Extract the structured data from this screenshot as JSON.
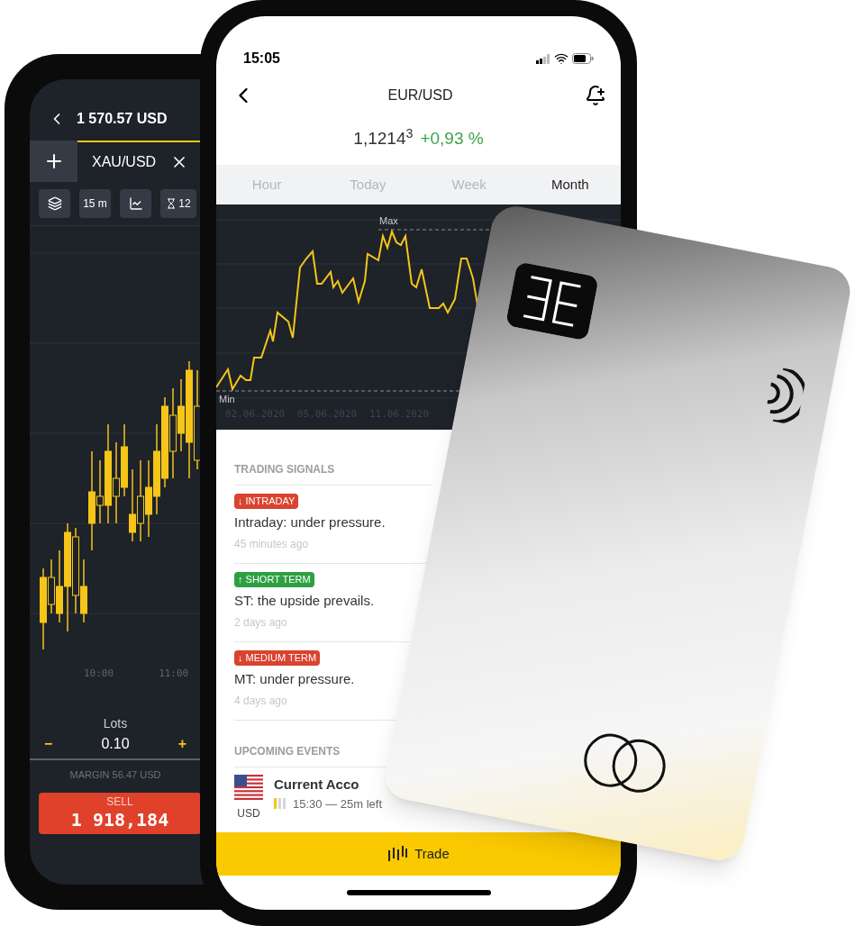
{
  "back_phone": {
    "header": {
      "balance": "1 570.57 USD"
    },
    "tabs": [
      {
        "label": "XAU/USD",
        "selected": true
      }
    ],
    "toolbar": {
      "interval": "15 m",
      "indicator_count": "12"
    },
    "chart": {
      "time_labels": [
        "10:00",
        "11:00"
      ]
    },
    "order": {
      "lots_label": "Lots",
      "minus": "−",
      "plus": "+",
      "lots_value": "0.10",
      "margin": "MARGIN 56.47 USD",
      "sell_label": "SELL",
      "sell_price": "1 918,184"
    }
  },
  "front_phone": {
    "status_bar": {
      "time": "15:05"
    },
    "header": {
      "title": "EUR/USD",
      "price": "1,1214$^{3}$",
      "change": "+0,93 %"
    },
    "periods": [
      {
        "label": "Hour",
        "selected": false
      },
      {
        "label": "Today",
        "selected": false
      },
      {
        "label": "Week",
        "selected": false
      },
      {
        "label": "Month",
        "selected": true
      }
    ],
    "chart": {
      "max_label": "Max",
      "min_label": "Min",
      "dates": [
        "02.06.2020",
        "05.06.2020",
        "11.06.2020"
      ]
    },
    "signals_title": "TRADING SIGNALS",
    "signals": [
      {
        "badge": "↓ INTRADAY",
        "color": "#d9432f",
        "text": "Intraday: under pressure.",
        "time": "45 minutes ago"
      },
      {
        "badge": "↑ SHORT TERM",
        "color": "#2ea043",
        "text": "ST: the upside prevails.",
        "time": "2 days ago"
      },
      {
        "badge": "↓ MEDIUM TERM",
        "color": "#d9432f",
        "text": "MT: under pressure.",
        "time": "4 days ago"
      }
    ],
    "events_title": "UPCOMING EVENTS",
    "events": [
      {
        "currency": "USD",
        "title": "Current Acco",
        "level": 0.33,
        "time": "15:30 — 25m left"
      }
    ],
    "trade_button": "Trade"
  }
}
